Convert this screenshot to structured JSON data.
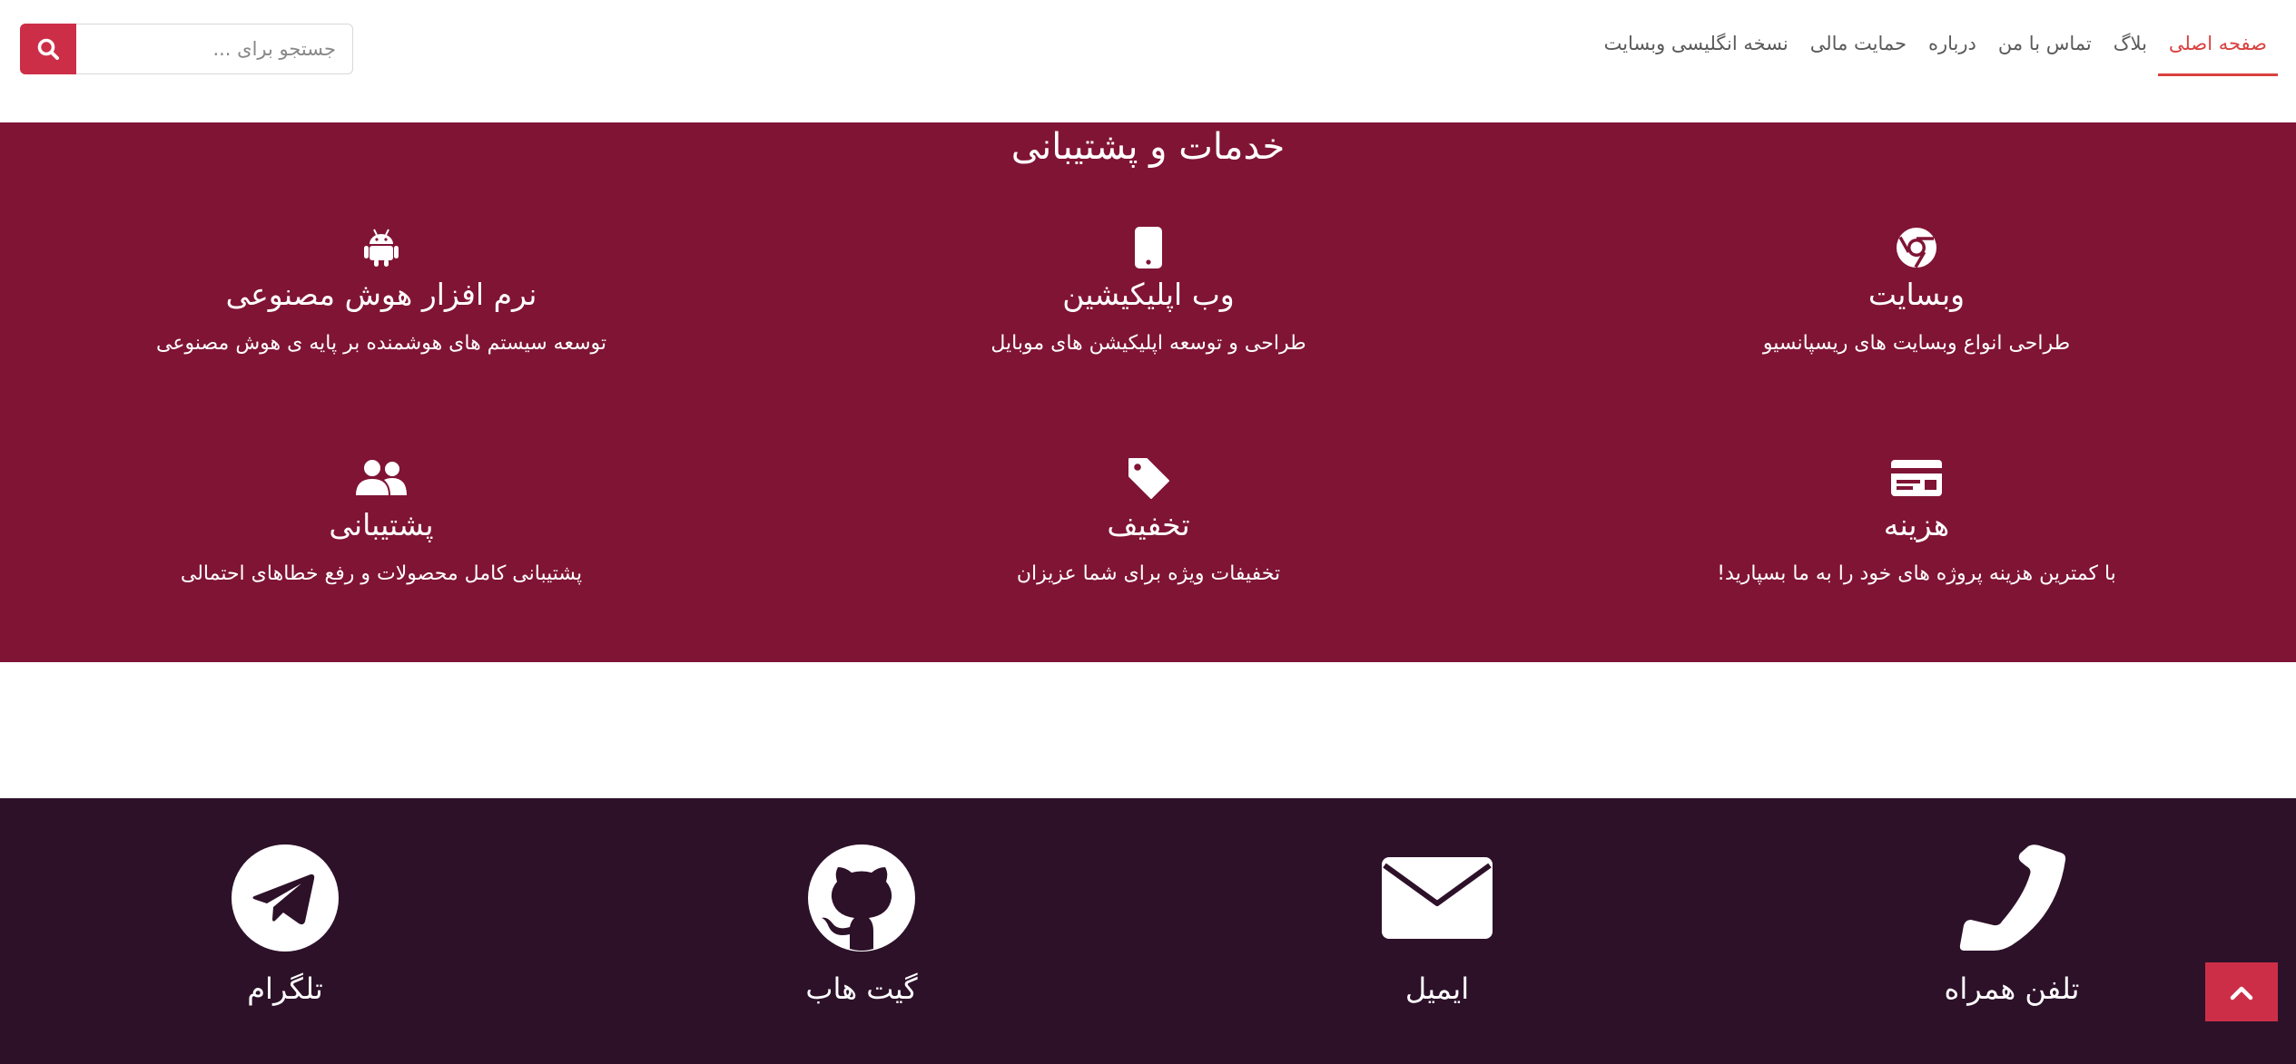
{
  "nav": {
    "items": [
      {
        "label": "صفحه اصلی",
        "active": true
      },
      {
        "label": "بلاگ",
        "active": false
      },
      {
        "label": "تماس با من",
        "active": false
      },
      {
        "label": "درباره",
        "active": false
      },
      {
        "label": "حمایت مالی",
        "active": false
      },
      {
        "label": "نسخه انگلیسی وبسایت",
        "active": false
      }
    ]
  },
  "search": {
    "placeholder": "جستجو برای ...",
    "icon": "search-icon"
  },
  "services": {
    "title": "خدمات و پشتیبانی",
    "items": [
      {
        "icon": "chrome-icon",
        "name": "وبسایت",
        "desc": "طراحی انواع وبسایت های ریسپانسیو"
      },
      {
        "icon": "mobile-icon",
        "name": "وب اپلیکیشین",
        "desc": "طراحی و توسعه اپلیکیشن های موبایل"
      },
      {
        "icon": "android-icon",
        "name": "نرم افزار هوش مصنوعی",
        "desc": "توسعه سیستم های هوشمنده بر پایه ی هوش مصنوعی"
      },
      {
        "icon": "credit-card-icon",
        "name": "هزینه",
        "desc": "با کمترین هزینه پروژه های خود را به ما بسپارید!"
      },
      {
        "icon": "tag-icon",
        "name": "تخفیف",
        "desc": "تخفیفات ویژه برای شما عزیزان"
      },
      {
        "icon": "users-icon",
        "name": "پشتیبانی",
        "desc": "پشتیبانی کامل محصولات و رفع خطاهای احتمالی"
      }
    ]
  },
  "contact": {
    "items": [
      {
        "icon": "phone-icon",
        "label": "تلفن همراه"
      },
      {
        "icon": "envelope-icon",
        "label": "ایمیل"
      },
      {
        "icon": "github-icon",
        "label": "گیت هاب"
      },
      {
        "icon": "telegram-icon",
        "label": "تلگرام"
      }
    ]
  },
  "colors": {
    "accent": "#cc2e47",
    "nav_active": "#d9413f",
    "services_bg": "#801435",
    "footer_bg": "#2d1129"
  },
  "scroll_top": {
    "icon": "chevron-up-icon"
  }
}
